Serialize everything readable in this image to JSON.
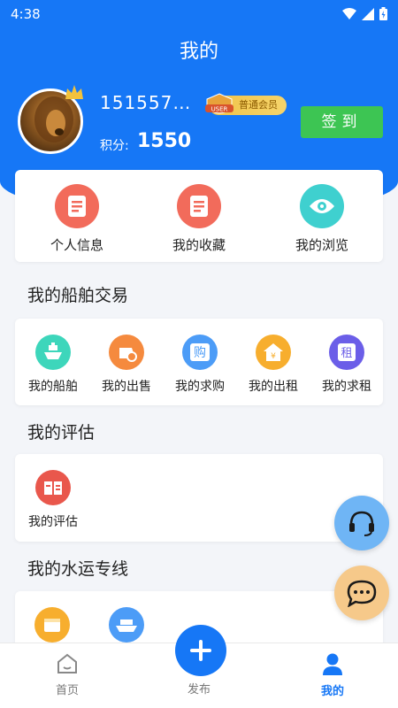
{
  "status": {
    "time": "4:38"
  },
  "header": {
    "title": "我的"
  },
  "profile": {
    "username": "151557…",
    "member_label": "普通会员",
    "member_badge_text": "USER",
    "points_label": "积分:",
    "points_value": "1550",
    "signin_label": "签到"
  },
  "quick_links": [
    {
      "label": "个人信息",
      "icon": "document-icon"
    },
    {
      "label": "我的收藏",
      "icon": "document-icon"
    },
    {
      "label": "我的浏览",
      "icon": "eye-icon"
    }
  ],
  "ship_trade": {
    "title": "我的船舶交易",
    "items": [
      {
        "label": "我的船舶",
        "icon": "ship-icon"
      },
      {
        "label": "我的出售",
        "icon": "sale-icon"
      },
      {
        "label": "我的求购",
        "icon": "buy-icon",
        "glyph": "购"
      },
      {
        "label": "我的出租",
        "icon": "house-icon"
      },
      {
        "label": "我的求租",
        "icon": "rent-icon",
        "glyph": "租"
      }
    ]
  },
  "assessment": {
    "title": "我的评估",
    "items": [
      {
        "label": "我的评估",
        "icon": "assessment-icon"
      }
    ]
  },
  "water": {
    "title": "我的水运专线",
    "items": [
      {
        "icon": "folder-icon"
      },
      {
        "icon": "cargo-ship-icon"
      }
    ]
  },
  "tabs": [
    {
      "label": "首页",
      "icon": "home-icon"
    },
    {
      "label": "发布",
      "icon": "plus-icon"
    },
    {
      "label": "我的",
      "icon": "user-icon"
    }
  ],
  "colors": {
    "primary": "#1677f6",
    "signin": "#3dc553"
  }
}
